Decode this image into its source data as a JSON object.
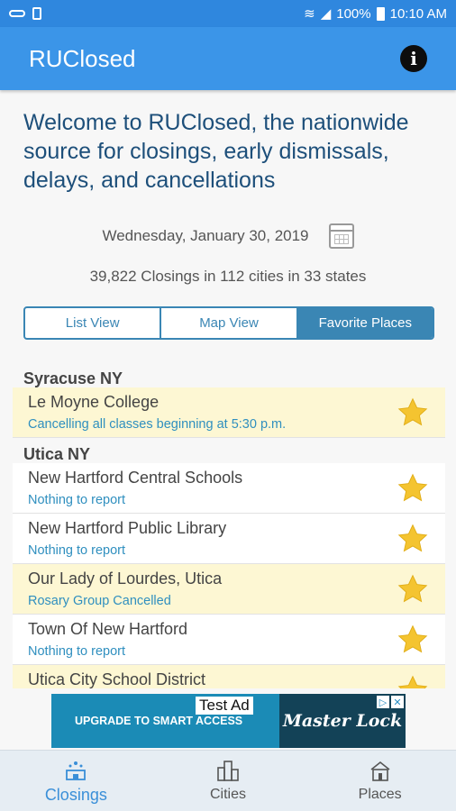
{
  "status_bar": {
    "battery": "100%",
    "time": "10:10 AM"
  },
  "app_bar": {
    "title": "RUClosed"
  },
  "welcome": "Welcome to RUClosed, the nationwide source for closings, early dismissals, delays, and cancellations",
  "date": "Wednesday, January 30, 2019",
  "summary": "39,822 Closings in 112 cities in 33 states",
  "tabs": [
    {
      "label": "List View",
      "active": false
    },
    {
      "label": "Map View",
      "active": false
    },
    {
      "label": "Favorite Places",
      "active": true
    }
  ],
  "groups": [
    {
      "city": "Syracuse NY",
      "items": [
        {
          "name": "Le Moyne College",
          "status": "Cancelling all classes beginning at 5:30 p.m.",
          "highlighted": true
        }
      ]
    },
    {
      "city": "Utica NY",
      "items": [
        {
          "name": "New Hartford Central Schools",
          "status": "Nothing to report",
          "highlighted": false
        },
        {
          "name": "New Hartford Public Library",
          "status": "Nothing to report",
          "highlighted": false
        },
        {
          "name": "Our Lady of Lourdes, Utica",
          "status": "Rosary Group Cancelled",
          "highlighted": true
        },
        {
          "name": "Town Of New Hartford",
          "status": "Nothing to report",
          "highlighted": false
        },
        {
          "name": "Utica City School District",
          "status": "",
          "highlighted": true
        }
      ]
    }
  ],
  "ad": {
    "label": "Test Ad",
    "text": "UPGRADE TO SMART ACCESS",
    "brand": "Master Lock"
  },
  "bottom_nav": [
    {
      "label": "Closings",
      "icon": "closings-icon",
      "active": true
    },
    {
      "label": "Cities",
      "icon": "cities-icon",
      "active": false
    },
    {
      "label": "Places",
      "icon": "places-icon",
      "active": false
    }
  ],
  "colors": {
    "app_bar": "#3b95e8",
    "status_bar": "#2f87de",
    "tab_accent": "#3a86b4",
    "highlight_row": "#fdf7d3",
    "star": "#f4c430",
    "welcome_text": "#1d4f7a"
  }
}
